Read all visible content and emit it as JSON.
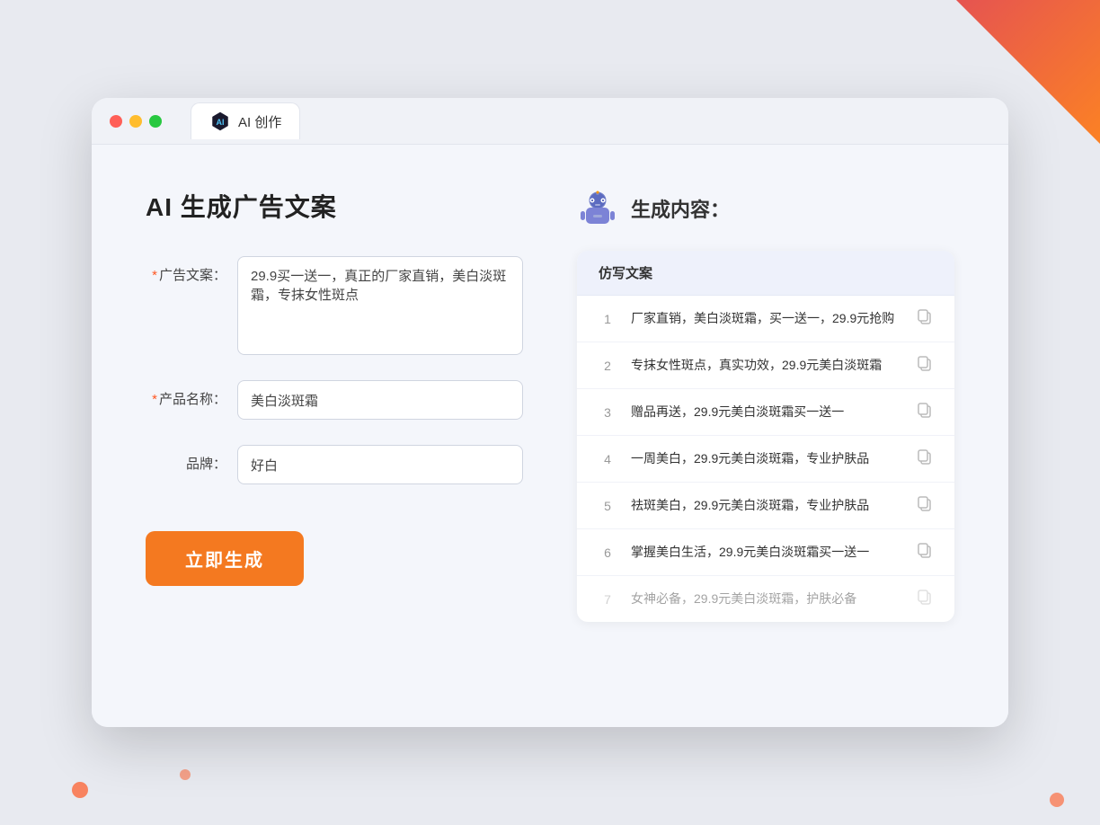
{
  "window": {
    "tab_label": "AI 创作"
  },
  "page": {
    "title": "AI 生成广告文案",
    "result_title": "生成内容："
  },
  "form": {
    "ad_copy_label": "广告文案：",
    "ad_copy_required": "*",
    "ad_copy_value": "29.9买一送一，真正的厂家直销，美白淡斑霜，专抹女性斑点",
    "product_name_label": "产品名称：",
    "product_name_required": "*",
    "product_name_value": "美白淡斑霜",
    "brand_label": "品牌：",
    "brand_value": "好白",
    "generate_btn_label": "立即生成"
  },
  "results": {
    "column_header": "仿写文案",
    "items": [
      {
        "num": "1",
        "text": "厂家直销，美白淡斑霜，买一送一，29.9元抢购",
        "dimmed": false
      },
      {
        "num": "2",
        "text": "专抹女性斑点，真实功效，29.9元美白淡斑霜",
        "dimmed": false
      },
      {
        "num": "3",
        "text": "赠品再送，29.9元美白淡斑霜买一送一",
        "dimmed": false
      },
      {
        "num": "4",
        "text": "一周美白，29.9元美白淡斑霜，专业护肤品",
        "dimmed": false
      },
      {
        "num": "5",
        "text": "祛斑美白，29.9元美白淡斑霜，专业护肤品",
        "dimmed": false
      },
      {
        "num": "6",
        "text": "掌握美白生活，29.9元美白淡斑霜买一送一",
        "dimmed": false
      },
      {
        "num": "7",
        "text": "女神必备，29.9元美白淡斑霜，护肤必备",
        "dimmed": true
      }
    ]
  },
  "colors": {
    "accent": "#f47920",
    "required": "#ff5722",
    "primary": "#4a6cf7"
  }
}
